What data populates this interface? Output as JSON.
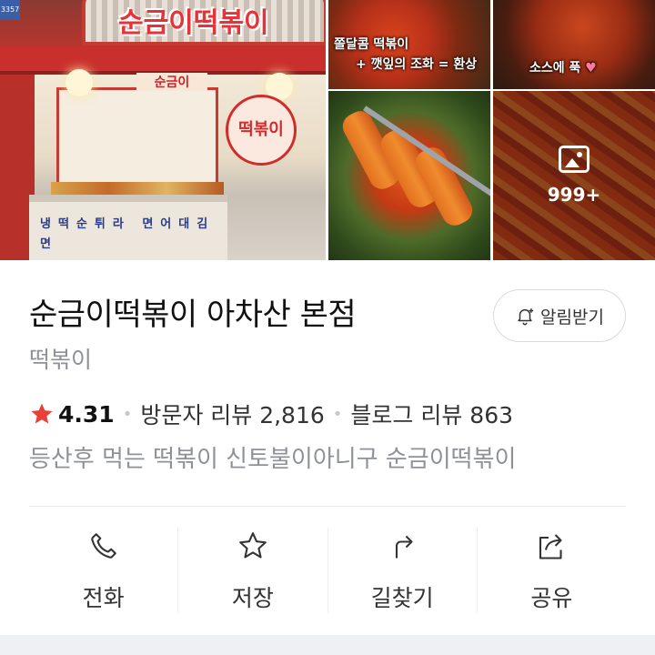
{
  "photos": {
    "storefront_sign": "순금이떡볶이",
    "menu_board": "순금이",
    "door_sign": "떡볶이",
    "counter_text": "냉떡순튀라 면어대김면",
    "address_tag": "3357",
    "food_caption_1": "쫄달콤 떡볶이",
    "food_caption_2": "+ 깻잎의 조화 = 환상",
    "food_caption_3": "소스에 푹",
    "more_count": "999+"
  },
  "place": {
    "name": "순금이떡볶이 아차산 본점",
    "category": "떡볶이",
    "rating": "4.31",
    "visitor_reviews": "방문자 리뷰 2,816",
    "blog_reviews": "블로그 리뷰 863",
    "description": "등산후 먹는 떡볶이 신토불이아니구 순금이떡볶이"
  },
  "notify_button": {
    "label": "알림받기"
  },
  "actions": [
    {
      "label": "전화",
      "icon": "phone-icon"
    },
    {
      "label": "저장",
      "icon": "star-outline-icon"
    },
    {
      "label": "길찾기",
      "icon": "directions-icon"
    },
    {
      "label": "공유",
      "icon": "share-icon"
    }
  ],
  "colors": {
    "star": "#e8403b",
    "text_primary": "#111111",
    "text_secondary": "#8e9297"
  }
}
